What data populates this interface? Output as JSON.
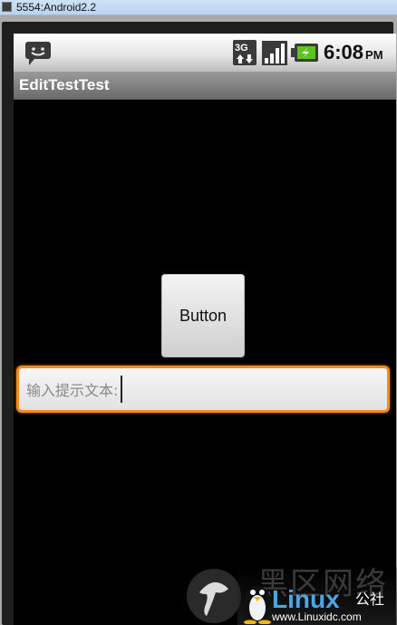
{
  "window": {
    "title": "5554:Android2.2"
  },
  "status_bar": {
    "time": "6:08",
    "ampm": "PM",
    "network": "3G"
  },
  "app": {
    "title": "EditTestTest"
  },
  "button": {
    "label": "Button"
  },
  "edit_text": {
    "hint": "输入提示文本:"
  },
  "watermark": {
    "chinese": "黑区网络",
    "linux": "Linux",
    "gongshe": "公社",
    "url": "www.Linuxidc.com"
  },
  "colors": {
    "focus_border": "#f08c1c",
    "status_bar_bg": "#e6e6e6",
    "title_bar_bg": "#7a7a7a",
    "screen_bg": "#000000"
  }
}
